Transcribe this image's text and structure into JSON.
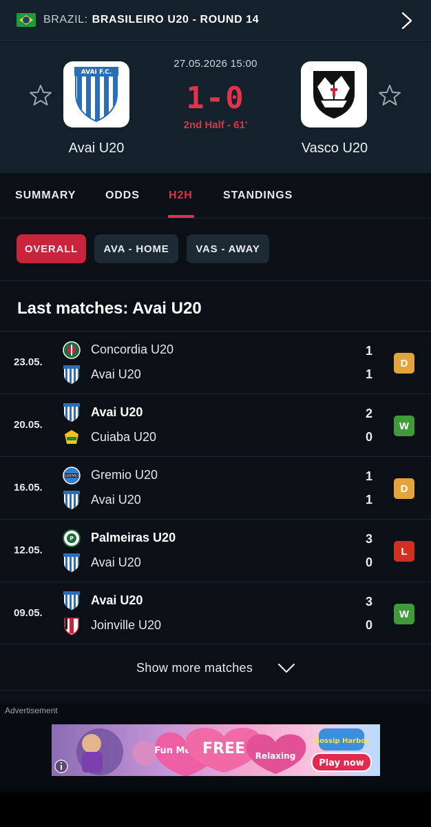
{
  "header": {
    "country": "BRAZIL:",
    "league": "BRASILEIRO U20 - ROUND 14"
  },
  "match": {
    "kickoff": "27.05.2026 15:00",
    "score": "1-0",
    "status": "2nd Half - 61'",
    "home_team": "Avai U20",
    "away_team": "Vasco U20",
    "home_crest_text": "AVAI F.C."
  },
  "tabs": [
    "SUMMARY",
    "ODDS",
    "H2H",
    "STANDINGS"
  ],
  "active_tab": "H2H",
  "filters": [
    "OVERALL",
    "AVA - HOME",
    "VAS - AWAY"
  ],
  "active_filter": "OVERALL",
  "section_title": "Last matches: Avai U20",
  "matches": [
    {
      "date": "23.05.",
      "team1": "Concordia U20",
      "team2": "Avai U20",
      "score1": "1",
      "score2": "1",
      "result": "D",
      "bold": 0
    },
    {
      "date": "20.05.",
      "team1": "Avai U20",
      "team2": "Cuiaba U20",
      "score1": "2",
      "score2": "0",
      "result": "W",
      "bold": 1
    },
    {
      "date": "16.05.",
      "team1": "Gremio U20",
      "team2": "Avai U20",
      "score1": "1",
      "score2": "1",
      "result": "D",
      "bold": 0
    },
    {
      "date": "12.05.",
      "team1": "Palmeiras U20",
      "team2": "Avai U20",
      "score1": "3",
      "score2": "0",
      "result": "L",
      "bold": 1
    },
    {
      "date": "09.05.",
      "team1": "Avai U20",
      "team2": "Joinville U20",
      "score1": "3",
      "score2": "0",
      "result": "W",
      "bold": 1
    }
  ],
  "result_colors": {
    "W": "#3f9a3a",
    "D": "#e3a53b",
    "L": "#d2301f"
  },
  "show_more": "Show more matches",
  "advertisement_label": "Advertisement",
  "ad": {
    "words": [
      "Fun Merge",
      "FREE",
      "Relaxing",
      "Gossip Harbor",
      "Play now"
    ]
  },
  "icons": {
    "flag": "brazil-flag-icon",
    "nav": "chevron-right-icon",
    "favorite": "star-outline-icon",
    "expand": "chevron-down-icon",
    "ad_info": "info-icon"
  }
}
